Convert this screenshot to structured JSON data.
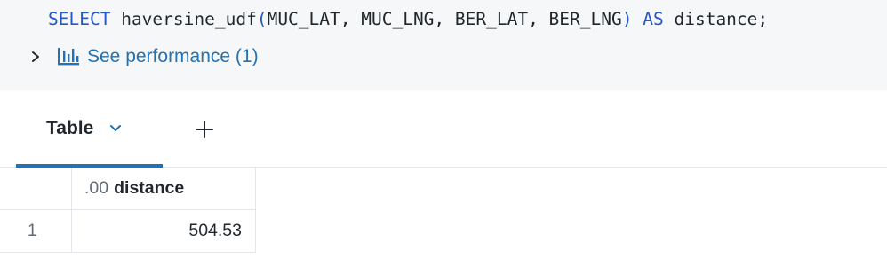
{
  "editor": {
    "kw_select": "SELECT",
    "function_name": "haversine_udf",
    "open_paren": "(",
    "args": "MUC_LAT, MUC_LNG, BER_LAT, BER_LNG",
    "close_paren": ")",
    "kw_as": "AS",
    "alias": "distance;"
  },
  "performance": {
    "label": "See performance (1)",
    "icon": "bar-chart-icon",
    "expand_icon": "chevron-right-icon"
  },
  "tabs": {
    "active": {
      "label": "Table",
      "icon": "chevron-down-icon"
    },
    "add_icon": "plus-icon"
  },
  "results": {
    "columns": [
      {
        "type_badge": ".00",
        "name": "distance"
      }
    ],
    "rows": [
      {
        "index": "1",
        "values": [
          "504.53"
        ]
      }
    ]
  },
  "colors": {
    "accent": "#2272b4",
    "keyword": "#2458c4",
    "editor_bg": "#f6f7f9",
    "border": "#e3e6ea"
  }
}
